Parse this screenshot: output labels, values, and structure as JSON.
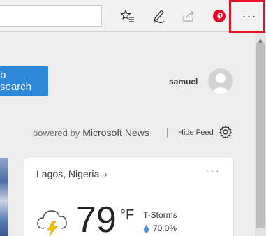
{
  "toolbar": {
    "icons": [
      "favorites-list-icon",
      "pen-icon",
      "share-icon",
      "pinterest-icon"
    ],
    "more_label": "···",
    "accent_highlight": "#e81123"
  },
  "page": {
    "search_button": "b search",
    "username": "samuel",
    "powered_by": "powered by",
    "brand": "Microsoft News",
    "separator": "|",
    "hide_feed": "Hide Feed"
  },
  "weather": {
    "location": "Lagos, Nigeria",
    "chevron": "›",
    "more": "···",
    "temperature": "79",
    "unit": "°F",
    "condition": "T-Storms",
    "precipitation": "70.0%"
  },
  "colors": {
    "search_blue": "#2b88d8",
    "pinterest_red": "#e60023"
  }
}
